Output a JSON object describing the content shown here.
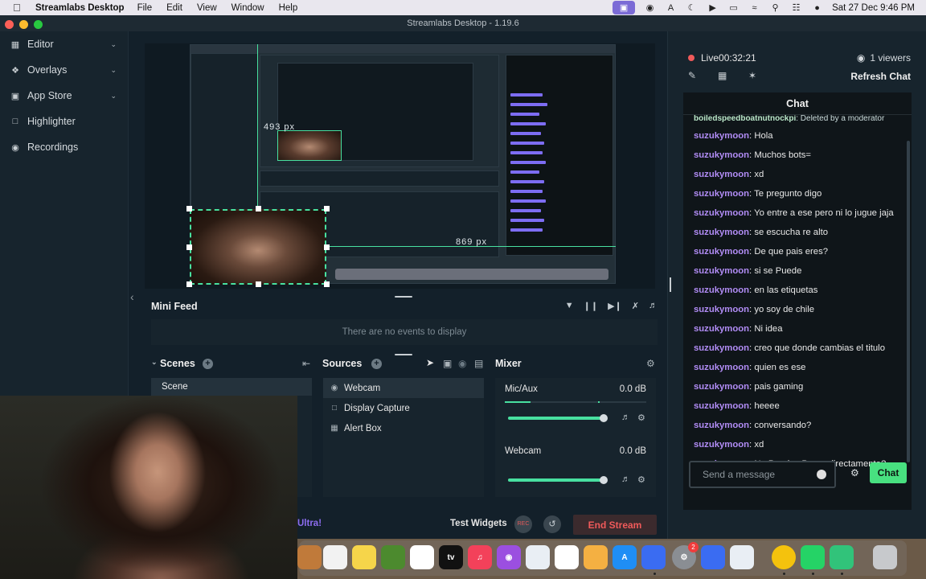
{
  "menubar": {
    "app_name": "Streamlabs Desktop",
    "menus": [
      "File",
      "Edit",
      "View",
      "Window",
      "Help"
    ],
    "clock": "Sat 27 Dec  9:46 PM"
  },
  "window": {
    "title": "Streamlabs Desktop - 1.19.6"
  },
  "leftnav": {
    "items": [
      {
        "label": "Editor",
        "icon": "editor-icon",
        "has_chevron": true
      },
      {
        "label": "Overlays",
        "icon": "overlays-icon",
        "has_chevron": true
      },
      {
        "label": "App Store",
        "icon": "app-store-icon",
        "has_chevron": true
      },
      {
        "label": "Highlighter",
        "icon": "highlighter-icon",
        "has_chevron": false
      },
      {
        "label": "Recordings",
        "icon": "recordings-icon",
        "has_chevron": false
      }
    ]
  },
  "preview": {
    "size_label_width": "493 px",
    "size_label_height": "869 px"
  },
  "minifeed": {
    "title": "Mini Feed",
    "empty_text": "There are no events to display"
  },
  "scenes": {
    "title": "Scenes",
    "items": [
      "Scene"
    ]
  },
  "sources": {
    "title": "Sources",
    "items": [
      {
        "label": "Webcam",
        "icon": "webcam-icon",
        "selected": true
      },
      {
        "label": "Display Capture",
        "icon": "display-capture-icon",
        "selected": false
      },
      {
        "label": "Alert Box",
        "icon": "alert-box-icon",
        "selected": false
      }
    ]
  },
  "mixer": {
    "title": "Mixer",
    "channels": [
      {
        "name": "Mic/Aux",
        "db": "0.0 dB"
      },
      {
        "name": "Webcam",
        "db": "0.0 dB"
      }
    ]
  },
  "footer": {
    "ultra_label": "Ultra!",
    "test_widgets": "Test Widgets",
    "rec_label": "REC",
    "end_stream": "End Stream"
  },
  "right_panel": {
    "live_time": "Live00:32:21",
    "viewers": "1 viewers",
    "refresh_chat": "Refresh Chat"
  },
  "chat": {
    "header": "Chat",
    "deleted_line": {
      "user": "boiledspeedboatnutnockpi",
      "text": ": Deleted by a moderator"
    },
    "messages": [
      {
        "user": "suzukymoon",
        "text": ": Hola"
      },
      {
        "user": "suzukymoon",
        "text": ": Muchos bots="
      },
      {
        "user": "suzukymoon",
        "text": ": xd"
      },
      {
        "user": "suzukymoon",
        "text": ": Te pregunto digo"
      },
      {
        "user": "suzukymoon",
        "text": ": Yo entre a ese pero ni lo jugue jaja"
      },
      {
        "user": "suzukymoon",
        "text": ": se escucha re alto"
      },
      {
        "user": "suzukymoon",
        "text": ": De que pais eres?"
      },
      {
        "user": "suzukymoon",
        "text": ": si se Puede"
      },
      {
        "user": "suzukymoon",
        "text": ": en las etiquetas"
      },
      {
        "user": "suzukymoon",
        "text": ": yo soy de chile"
      },
      {
        "user": "suzukymoon",
        "text": ": Ni idea"
      },
      {
        "user": "suzukymoon",
        "text": ": creo que donde cambias el titulo"
      },
      {
        "user": "suzukymoon",
        "text": ": quien es ese"
      },
      {
        "user": "suzukymoon",
        "text": ": pais gaming"
      },
      {
        "user": "suzukymoon",
        "text": ": heeee"
      },
      {
        "user": "suzukymoon",
        "text": ": conversando?"
      },
      {
        "user": "suzukymoon",
        "text": ": xd"
      },
      {
        "user": "suzukymoon",
        "text": ": No Puedes Poner directamente?"
      }
    ],
    "input_placeholder": "Send a message",
    "send_button": "Chat"
  },
  "dock": {
    "apps": [
      "reminders-icon",
      "notes-icon",
      "minecraft-icon",
      "freeform-icon",
      "apple-tv-icon",
      "music-icon",
      "podcasts-icon",
      "keynote-icon",
      "numbers-icon",
      "pages-icon",
      "app-store-dock-icon",
      "xcode-icon",
      "system-settings-icon",
      "docs-icon",
      "pdf-icon",
      "chrome-icon",
      "whatsapp-icon",
      "streamlabs-icon",
      "trash-icon"
    ],
    "apple_tv_label": "tv",
    "settings_badge": "2"
  }
}
